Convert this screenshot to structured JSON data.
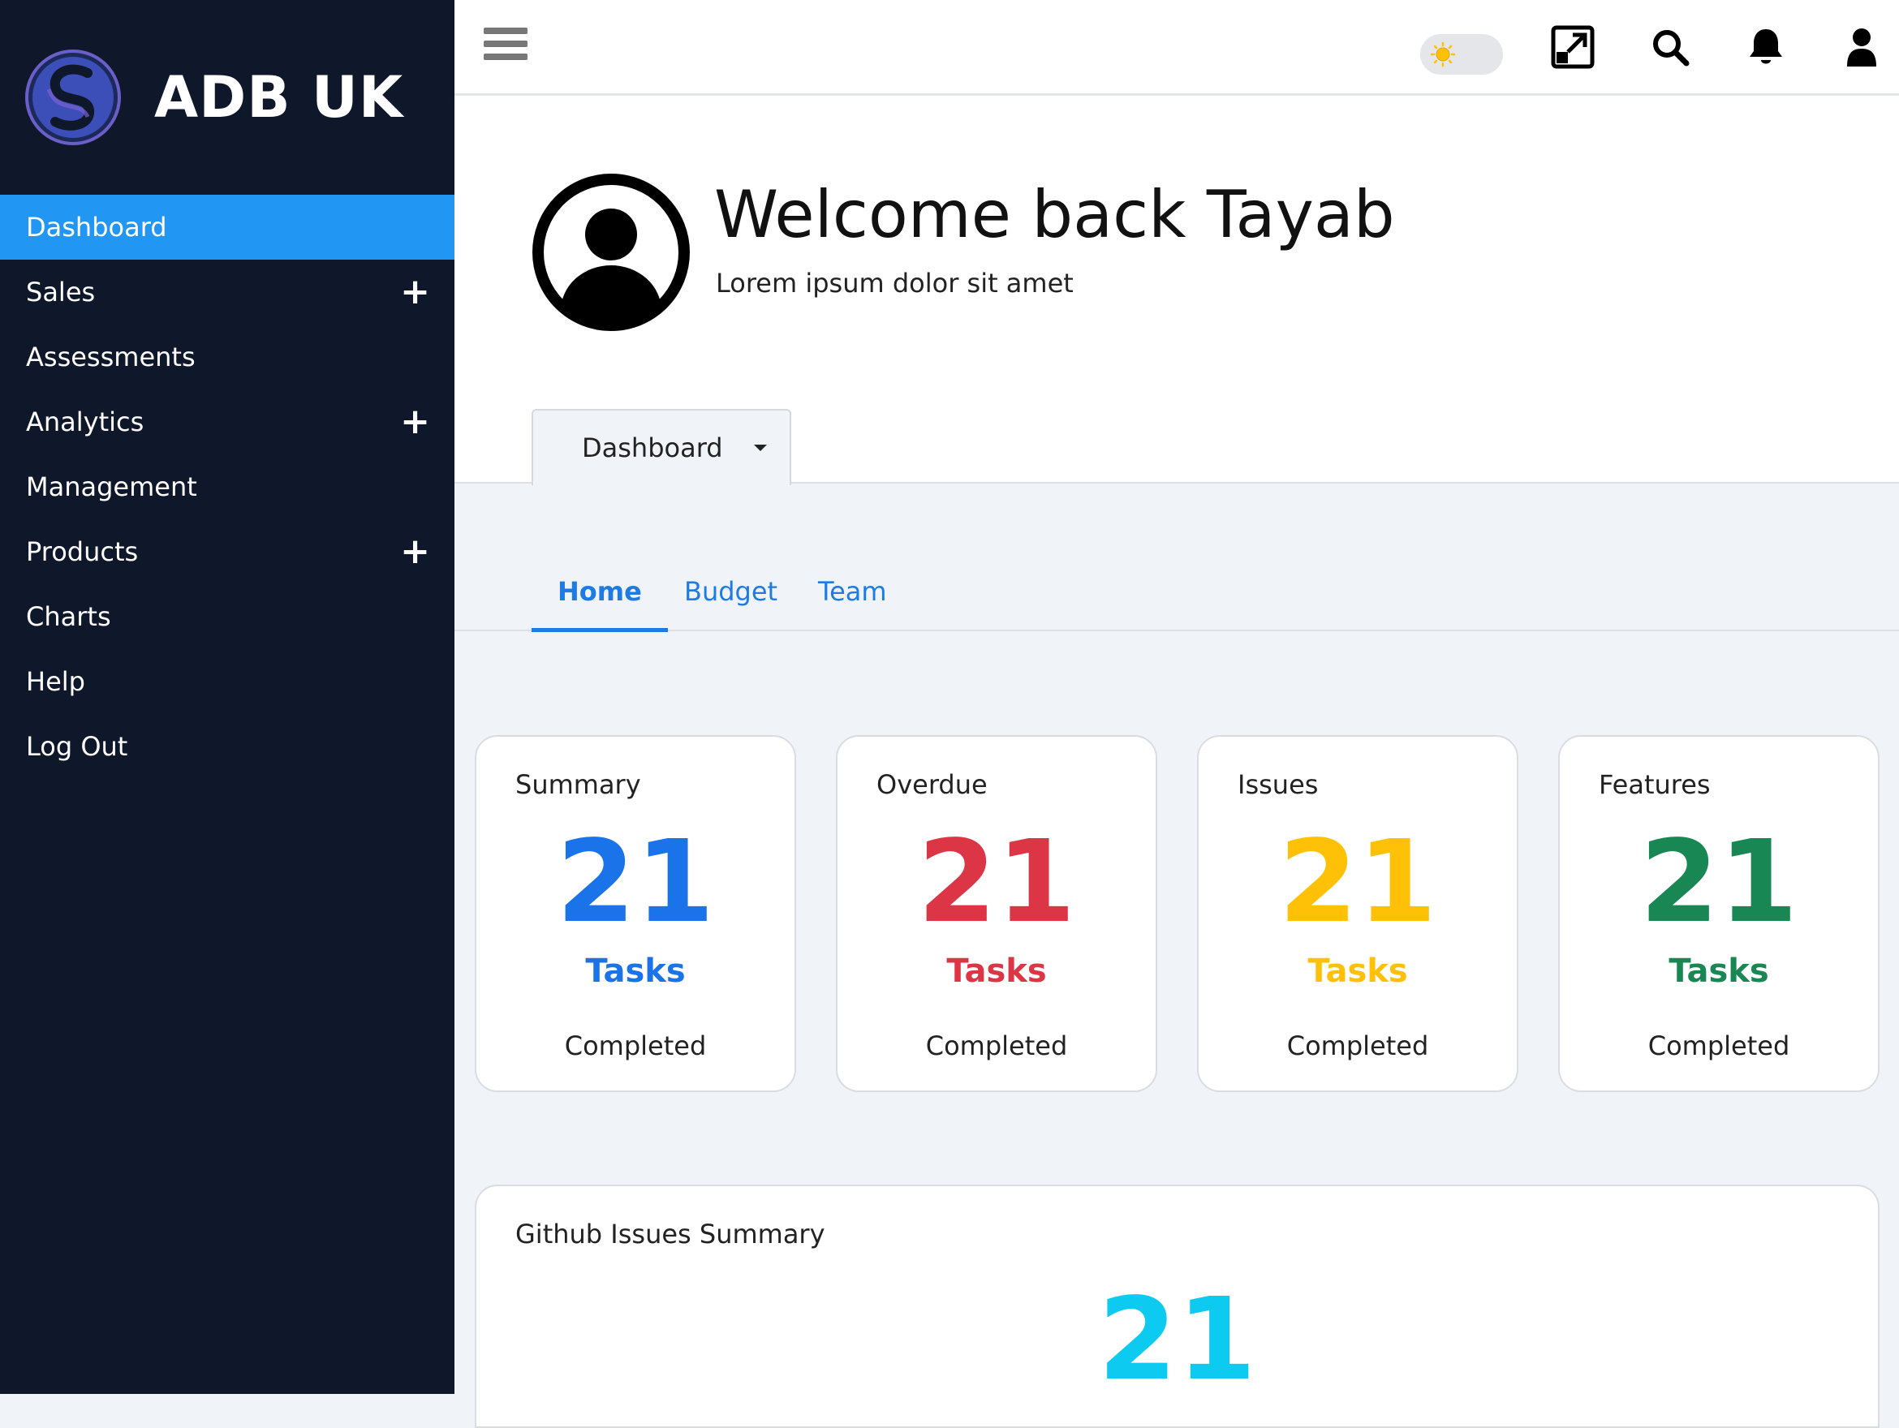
{
  "brand": {
    "name": "ADB UK"
  },
  "sidebar": {
    "items": [
      {
        "label": "Dashboard",
        "active": true,
        "expandable": false
      },
      {
        "label": "Sales",
        "active": false,
        "expandable": true
      },
      {
        "label": "Assessments",
        "active": false,
        "expandable": false
      },
      {
        "label": "Analytics",
        "active": false,
        "expandable": true
      },
      {
        "label": "Management",
        "active": false,
        "expandable": false
      },
      {
        "label": "Products",
        "active": false,
        "expandable": true
      },
      {
        "label": "Charts",
        "active": false,
        "expandable": false
      },
      {
        "label": "Help",
        "active": false,
        "expandable": false
      },
      {
        "label": "Log Out",
        "active": false,
        "expandable": false
      }
    ]
  },
  "topbar": {
    "icons": [
      "menu-icon",
      "theme-toggle",
      "expand-icon",
      "search-icon",
      "bell-icon",
      "user-icon"
    ]
  },
  "welcome": {
    "title": "Welcome back Tayab",
    "subtitle": "Lorem ipsum dolor sit amet",
    "dropdown_label": "Dashboard"
  },
  "tabs": [
    {
      "label": "Home",
      "active": true
    },
    {
      "label": "Budget",
      "active": false
    },
    {
      "label": "Team",
      "active": false
    }
  ],
  "cards": [
    {
      "label": "Summary",
      "value": "21",
      "unit": "Tasks",
      "status": "Completed",
      "color": "#1a73e8"
    },
    {
      "label": "Overdue",
      "value": "21",
      "unit": "Tasks",
      "status": "Completed",
      "color": "#dc3545"
    },
    {
      "label": "Issues",
      "value": "21",
      "unit": "Tasks",
      "status": "Completed",
      "color": "#ffc107"
    },
    {
      "label": "Features",
      "value": "21",
      "unit": "Tasks",
      "status": "Completed",
      "color": "#198754"
    }
  ],
  "github": {
    "label": "Github Issues Summary",
    "value": "21",
    "color": "#0dcaf0"
  },
  "colors": {
    "sidebar_bg": "#0f172a",
    "active_nav": "#2196f3",
    "link": "#1e7be3"
  }
}
